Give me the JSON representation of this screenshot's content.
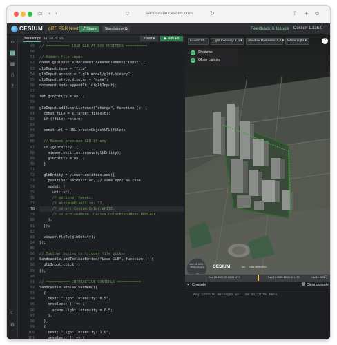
{
  "browser": {
    "url": "sandcastle.cesium.com"
  },
  "header": {
    "logo": "CESIUM",
    "project_name": "glTF PBR Next",
    "share_label": "Share",
    "standalone_label": "Standalone",
    "feedback_label": "Feedback & Issues",
    "version": "Cesium 1.136.0"
  },
  "editor": {
    "tabs": [
      "Javascript",
      "HTML/CSS"
    ],
    "insert_label": "Insert",
    "run_label": "Run",
    "run_key": "F8",
    "current_line": "78",
    "lines": [
      {
        "n": "49",
        "t": "// =========== LOAD GLB AT BOX POSITION ==========",
        "c": "cmt"
      },
      {
        "n": "50",
        "t": "",
        "c": ""
      },
      {
        "n": "51",
        "t": "// Hidden file input",
        "c": "cmt"
      },
      {
        "n": "52",
        "t": "const glbInput = document.createElement(\"input\");",
        "c": ""
      },
      {
        "n": "53",
        "t": "glbInput.type = \"file\";",
        "c": ""
      },
      {
        "n": "54",
        "t": "glbInput.accept = \".glb,model/gltf-binary\";",
        "c": ""
      },
      {
        "n": "55",
        "t": "glbInput.style.display = \"none\";",
        "c": ""
      },
      {
        "n": "56",
        "t": "document.body.appendChild(glbInput);",
        "c": ""
      },
      {
        "n": "57",
        "t": "",
        "c": ""
      },
      {
        "n": "58",
        "t": "let glbEntity = null;",
        "c": ""
      },
      {
        "n": "59",
        "t": "",
        "c": ""
      },
      {
        "n": "60",
        "t": "glbInput.addEventListener(\"change\", function (e) {",
        "c": ""
      },
      {
        "n": "61",
        "t": "  const file = e.target.files[0];",
        "c": ""
      },
      {
        "n": "62",
        "t": "  if (!file) return;",
        "c": ""
      },
      {
        "n": "63",
        "t": "",
        "c": ""
      },
      {
        "n": "64",
        "t": "  const url = URL.createObjectURL(file);",
        "c": ""
      },
      {
        "n": "65",
        "t": "",
        "c": ""
      },
      {
        "n": "66",
        "t": "  // Remove previous GLB if any",
        "c": "cmt"
      },
      {
        "n": "67",
        "t": "  if (glbEntity) {",
        "c": ""
      },
      {
        "n": "68",
        "t": "    viewer.entities.remove(glbEntity);",
        "c": ""
      },
      {
        "n": "69",
        "t": "    glbEntity = null;",
        "c": ""
      },
      {
        "n": "70",
        "t": "  }",
        "c": ""
      },
      {
        "n": "71",
        "t": "",
        "c": ""
      },
      {
        "n": "72",
        "t": "  glbEntity = viewer.entities.add({",
        "c": ""
      },
      {
        "n": "73",
        "t": "    position: boxPosition, // same spot as cube",
        "c": ""
      },
      {
        "n": "74",
        "t": "    model: {",
        "c": ""
      },
      {
        "n": "75",
        "t": "      uri: url,",
        "c": ""
      },
      {
        "n": "76",
        "t": "      // optional tweaks:",
        "c": "cmt"
      },
      {
        "n": "77",
        "t": "      // minimumPixelSize: 32,",
        "c": "cmt"
      },
      {
        "n": "78",
        "t": "      // color: Cesium.Color.WHITE,",
        "c": "cmt"
      },
      {
        "n": "79",
        "t": "      // colorBlendMode: Cesium.ColorBlendMode.REPLACE,",
        "c": "cmt"
      },
      {
        "n": "80",
        "t": "    },",
        "c": ""
      },
      {
        "n": "81",
        "t": "  });",
        "c": ""
      },
      {
        "n": "82",
        "t": "",
        "c": ""
      },
      {
        "n": "83",
        "t": "  viewer.flyTo(glbEntity);",
        "c": ""
      },
      {
        "n": "84",
        "t": "});",
        "c": ""
      },
      {
        "n": "85",
        "t": "",
        "c": ""
      },
      {
        "n": "86",
        "t": "// Toolbar button to trigger file picker",
        "c": "cmt"
      },
      {
        "n": "87",
        "t": "Sandcastle.addToolbarButton(\"Load GLB\", function () {",
        "c": ""
      },
      {
        "n": "88",
        "t": "  glbInput.click();",
        "c": ""
      },
      {
        "n": "89",
        "t": "});",
        "c": ""
      },
      {
        "n": "90",
        "t": "",
        "c": ""
      },
      {
        "n": "91",
        "t": "// =========== INTERACTIVE CONTROLS ===========",
        "c": "cmt"
      },
      {
        "n": "92",
        "t": "Sandcastle.addToolbarMenu([",
        "c": ""
      },
      {
        "n": "93",
        "t": "  {",
        "c": ""
      },
      {
        "n": "94",
        "t": "    text: \"Light Intensity: 0.5\",",
        "c": ""
      },
      {
        "n": "95",
        "t": "    onselect: () => {",
        "c": ""
      },
      {
        "n": "96",
        "t": "      scene.light.intensity = 0.5;",
        "c": ""
      },
      {
        "n": "97",
        "t": "    },",
        "c": ""
      },
      {
        "n": "98",
        "t": "  },",
        "c": ""
      },
      {
        "n": "99",
        "t": "  {",
        "c": ""
      },
      {
        "n": "100",
        "t": "    text: \"Light Intensity: 1.0\",",
        "c": ""
      },
      {
        "n": "101",
        "t": "    onselect: () => {",
        "c": ""
      },
      {
        "n": "102",
        "t": "      scene.light.intensity = 1.0;",
        "c": ""
      },
      {
        "n": "103",
        "t": "    },",
        "c": ""
      },
      {
        "n": "104",
        "t": "  },",
        "c": ""
      }
    ]
  },
  "viewer": {
    "toolbar": [
      "Load GLB",
      "Light Intensity: 1.0",
      "Shadow Darkness: 0.6",
      "White Light"
    ],
    "toggles": [
      "Shadows",
      "Globe Lighting"
    ],
    "help_label": "?",
    "dial_time": "Dec 10 2025 ... 00:00:00 UTC",
    "dial_rate": "1x",
    "credit": "CESIUM",
    "credit_sub": "ion",
    "data_attribution": "Data attribution",
    "timeline_start": "Dec 10 2025 00:00:00 UTC",
    "timeline_mid": "Dec 10 2025 12:00:00 UTC",
    "timeline_end": "Dec 11 2025"
  },
  "console": {
    "title": "Console",
    "clear_label": "Clear console",
    "message": "Any console messages will be mirrored here"
  },
  "colors": {
    "accent": "#2e7d4f",
    "project": "#f2c94c",
    "comment": "#6a9955"
  }
}
